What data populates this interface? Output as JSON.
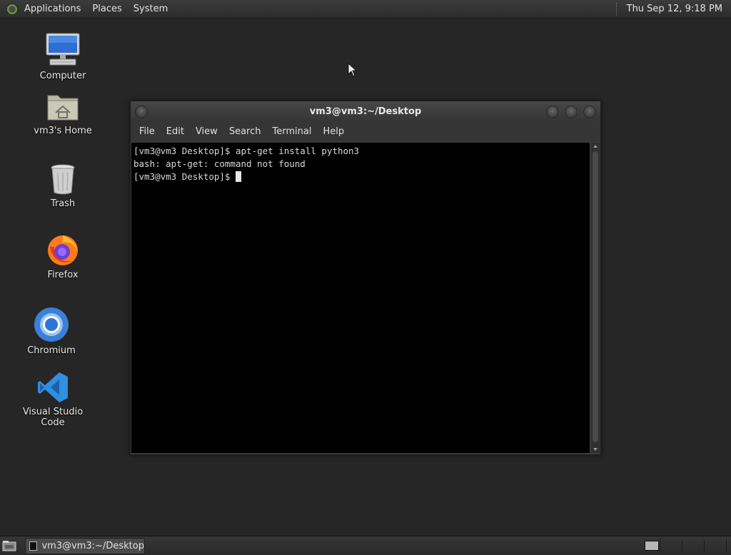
{
  "top_panel": {
    "menus": [
      "Applications",
      "Places",
      "System"
    ],
    "clock": "Thu Sep 12,  9:18 PM"
  },
  "desktop": {
    "icons": [
      {
        "label": "Computer",
        "icon": "computer-icon"
      },
      {
        "label": "vm3's Home",
        "icon": "home-folder-icon"
      },
      {
        "label": "Trash",
        "icon": "trash-icon"
      },
      {
        "label": "Firefox",
        "icon": "firefox-icon"
      },
      {
        "label": "Chromium",
        "icon": "chromium-icon"
      },
      {
        "label": "Visual Studio Code",
        "icon": "vscode-icon"
      }
    ]
  },
  "terminal": {
    "title": "vm3@vm3:~/Desktop",
    "menus": [
      "File",
      "Edit",
      "View",
      "Search",
      "Terminal",
      "Help"
    ],
    "lines": [
      "[vm3@vm3 Desktop]$ apt-get install python3",
      "bash: apt-get: command not found",
      "[vm3@vm3 Desktop]$ "
    ]
  },
  "bottom_panel": {
    "task_label": "vm3@vm3:~/Desktop"
  },
  "colors": {
    "desktop_bg": "#262626",
    "panel_bg": "#333333",
    "terminal_bg": "#000000",
    "vscode_blue": "#2f8fe0",
    "firefox_orange": "#ff7a1a",
    "chromium_blue": "#3b7fd6"
  }
}
